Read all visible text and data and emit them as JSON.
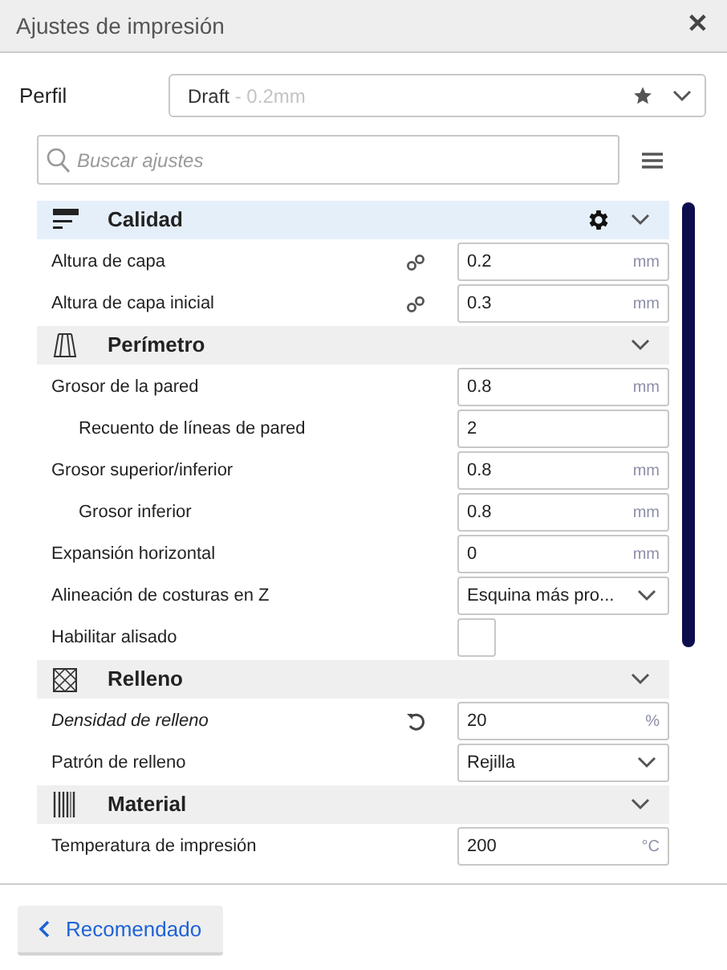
{
  "window": {
    "title": "Ajustes de impresión",
    "close": "✕"
  },
  "profile": {
    "label": "Perfil",
    "name": "Draft",
    "detail": " - 0.2mm"
  },
  "search": {
    "placeholder": "Buscar ajustes"
  },
  "sections": [
    {
      "kind": "quality",
      "title": "Calidad",
      "highlighted": true,
      "settings": [
        {
          "kind": "number",
          "label": "Altura de capa",
          "indented": false,
          "modified": false,
          "linked": true,
          "reset": false,
          "value": "0.2",
          "unit": "mm"
        },
        {
          "kind": "number",
          "label": "Altura de capa inicial",
          "indented": false,
          "modified": false,
          "linked": true,
          "reset": false,
          "value": "0.3",
          "unit": "mm"
        }
      ]
    },
    {
      "kind": "perimeter",
      "title": "Perímetro",
      "highlighted": false,
      "settings": [
        {
          "kind": "number",
          "label": "Grosor de la pared",
          "indented": false,
          "modified": false,
          "linked": false,
          "reset": false,
          "value": "0.8",
          "unit": "mm"
        },
        {
          "kind": "number",
          "label": "Recuento de líneas de pared",
          "indented": true,
          "modified": false,
          "linked": false,
          "reset": false,
          "value": "2"
        },
        {
          "kind": "number",
          "label": "Grosor superior/inferior",
          "indented": false,
          "modified": false,
          "linked": false,
          "reset": false,
          "value": "0.8",
          "unit": "mm"
        },
        {
          "kind": "number",
          "label": "Grosor inferior",
          "indented": true,
          "modified": false,
          "linked": false,
          "reset": false,
          "value": "0.8",
          "unit": "mm"
        },
        {
          "kind": "number",
          "label": "Expansión horizontal",
          "indented": false,
          "modified": false,
          "linked": false,
          "reset": false,
          "value": "0",
          "unit": "mm"
        },
        {
          "kind": "select",
          "label": "Alineación de costuras en Z",
          "indented": false,
          "modified": false,
          "linked": false,
          "reset": false,
          "value": "Esquina más pro..."
        },
        {
          "kind": "checkbox",
          "label": "Habilitar alisado",
          "indented": false,
          "modified": false,
          "linked": false,
          "reset": false,
          "checked": false
        }
      ]
    },
    {
      "kind": "infill",
      "title": "Relleno",
      "highlighted": false,
      "settings": [
        {
          "kind": "number",
          "label": "Densidad de relleno",
          "indented": false,
          "modified": true,
          "linked": false,
          "reset": true,
          "value": "20",
          "unit": "%"
        },
        {
          "kind": "select",
          "label": "Patrón de relleno",
          "indented": false,
          "modified": false,
          "linked": false,
          "reset": false,
          "value": "Rejilla"
        }
      ]
    },
    {
      "kind": "material",
      "title": "Material",
      "highlighted": false,
      "settings": [
        {
          "kind": "number",
          "label": "Temperatura de impresión",
          "indented": false,
          "modified": false,
          "linked": false,
          "reset": false,
          "value": "200",
          "unit": "°C"
        }
      ]
    }
  ],
  "footer": {
    "button": "Recomendado"
  }
}
